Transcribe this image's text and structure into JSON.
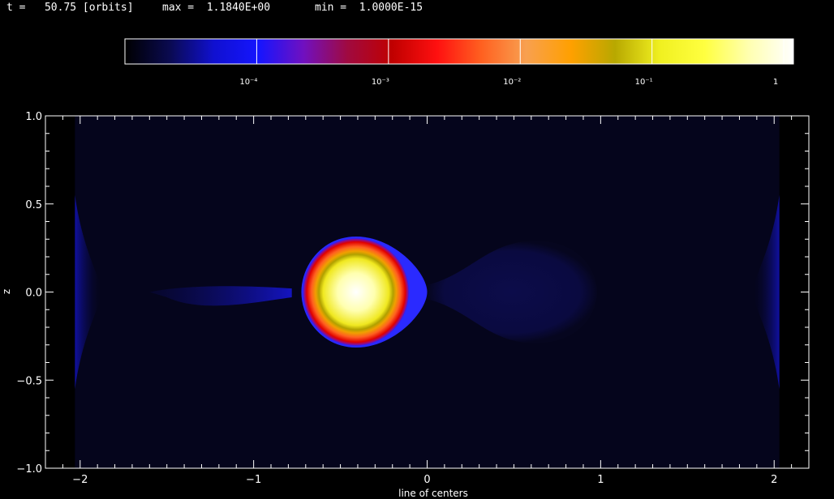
{
  "header": {
    "time_label": "t =   50.75 [orbits]",
    "max_label": "max =  1.1840E+00",
    "min_label": "min =  1.0000E-15"
  },
  "chart_data": {
    "type": "heatmap",
    "title": "",
    "xlabel": "line of centers",
    "ylabel": "z",
    "xlim": [
      -2.2,
      2.2
    ],
    "ylim": [
      -1.0,
      1.0
    ],
    "x_ticks": [
      {
        "value": -2,
        "label": "−2"
      },
      {
        "value": -1,
        "label": "−1"
      },
      {
        "value": 0,
        "label": "0"
      },
      {
        "value": 1,
        "label": "1"
      },
      {
        "value": 2,
        "label": "2"
      }
    ],
    "y_ticks": [
      {
        "value": 1.0,
        "label": "1.0"
      },
      {
        "value": 0.5,
        "label": "0.5"
      },
      {
        "value": 0.0,
        "label": "0.0"
      },
      {
        "value": -0.5,
        "label": "−0.5"
      },
      {
        "value": -1.0,
        "label": "−1.0"
      }
    ],
    "colorbar": {
      "scale": "log",
      "range": [
        1e-05,
        1.184
      ],
      "ticks": [
        {
          "value": 0.0001,
          "label": "10⁻⁴"
        },
        {
          "value": 0.001,
          "label": "10⁻³"
        },
        {
          "value": 0.01,
          "label": "10⁻²"
        },
        {
          "value": 0.1,
          "label": "10⁻¹"
        },
        {
          "value": 1,
          "label": "1"
        }
      ],
      "colors": [
        "#000000",
        "#0a0a50",
        "#1010d0",
        "#1515ff",
        "#7010c0",
        "#a00a40",
        "#c00000",
        "#ff1010",
        "#ff6020",
        "#f8a050",
        "#ffa000",
        "#b8a800",
        "#f0f020",
        "#ffff40",
        "#ffffb0",
        "#ffffff"
      ]
    },
    "structures": [
      {
        "name": "primary star",
        "center": [
          -0.41,
          0.0
        ],
        "radius": 0.315,
        "peak_density": 1.184
      },
      {
        "name": "companion lobe",
        "center": [
          0.69,
          0.0
        ],
        "radius": 0.29,
        "peak_density": 0.0001
      }
    ]
  }
}
